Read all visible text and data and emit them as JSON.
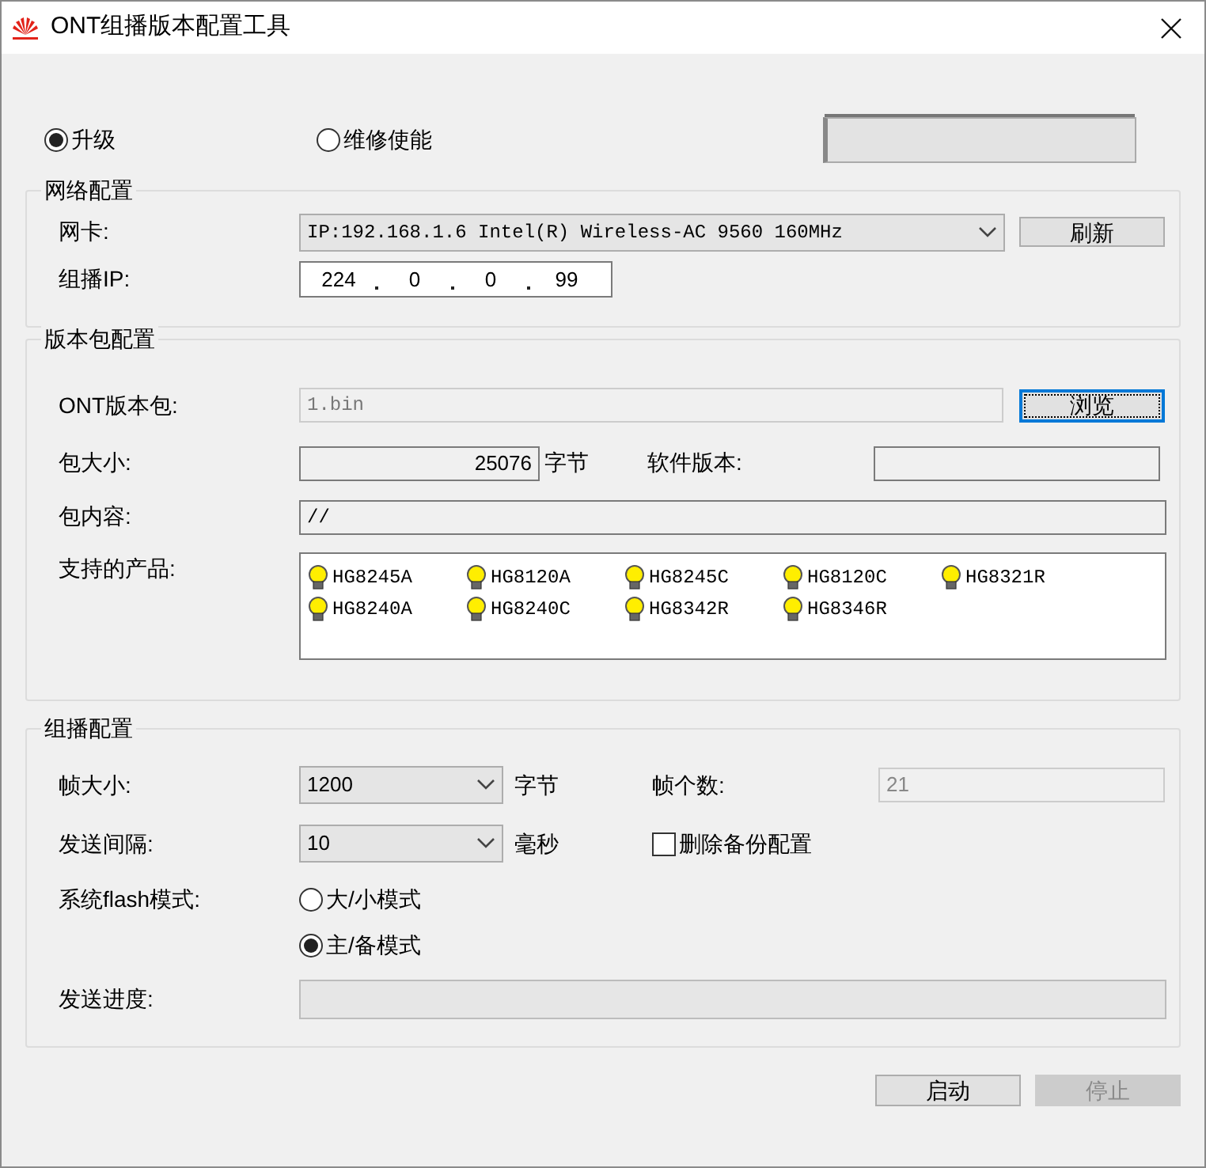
{
  "window": {
    "title": "ONT组播版本配置工具"
  },
  "mode_options": [
    {
      "label": "升级",
      "selected": true
    },
    {
      "label": "维修使能",
      "selected": false
    }
  ],
  "network": {
    "title": "网络配置",
    "nic_label": "网卡:",
    "nic_value": "IP:192.168.1.6 Intel(R) Wireless-AC 9560 160MHz",
    "refresh_button": "刷新",
    "multicast_ip_label": "组播IP:",
    "multicast_ip_octets": [
      "224",
      "0",
      "0",
      "99"
    ]
  },
  "package": {
    "title": "版本包配置",
    "file_label": "ONT版本包:",
    "file_value": "1.bin",
    "browse_button": "浏览",
    "size_label": "包大小:",
    "size_value": "25076",
    "size_unit": "字节",
    "software_version_label": "软件版本:",
    "content_label": "包内容:",
    "content_value": "//",
    "products_label": "支持的产品:",
    "products": [
      "HG8245A",
      "HG8120A",
      "HG8245C",
      "HG8120C",
      "HG8321R",
      "HG8240A",
      "HG8240C",
      "HG8342R",
      "HG8346R"
    ]
  },
  "multicast": {
    "title": "组播配置",
    "frame_size_label": "帧大小:",
    "frame_size_value": "1200",
    "frame_size_unit": "字节",
    "frame_count_label": "帧个数:",
    "frame_count_value": "21",
    "interval_label": "发送间隔:",
    "interval_value": "10",
    "interval_unit": "毫秒",
    "delete_backup": {
      "label": "删除备份配置",
      "checked": false
    },
    "flash_mode_label": "系统flash模式:",
    "flash_modes": [
      {
        "label": "大/小模式",
        "selected": false
      },
      {
        "label": "主/备模式",
        "selected": true
      }
    ],
    "progress_label": "发送进度:",
    "progress": {
      "level": 0
    }
  },
  "buttons": [
    {
      "label": "启动",
      "disabled": false
    },
    {
      "label": "停止",
      "disabled": true
    }
  ]
}
